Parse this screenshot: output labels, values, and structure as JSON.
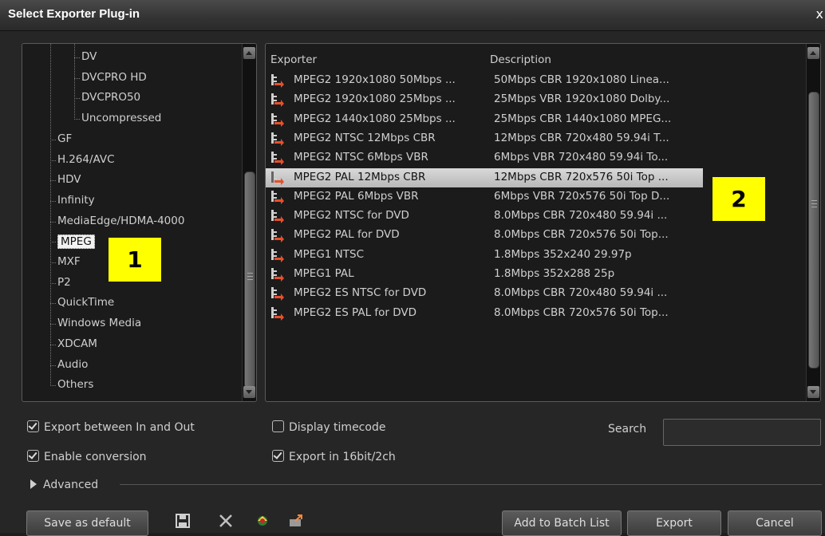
{
  "window": {
    "title": "Select Exporter Plug-in",
    "close_label": "x"
  },
  "tree": {
    "items": [
      {
        "label": "DV",
        "level": 2
      },
      {
        "label": "DVCPRO HD",
        "level": 2
      },
      {
        "label": "DVCPRO50",
        "level": 2
      },
      {
        "label": "Uncompressed",
        "level": 2
      },
      {
        "label": "GF",
        "level": 1
      },
      {
        "label": "H.264/AVC",
        "level": 1
      },
      {
        "label": "HDV",
        "level": 1
      },
      {
        "label": "Infinity",
        "level": 1
      },
      {
        "label": "MediaEdge/HDMA-4000",
        "level": 1
      },
      {
        "label": "MPEG",
        "level": 1,
        "selected": true
      },
      {
        "label": "MXF",
        "level": 1
      },
      {
        "label": "P2",
        "level": 1
      },
      {
        "label": "QuickTime",
        "level": 1
      },
      {
        "label": "Windows Media",
        "level": 1
      },
      {
        "label": "XDCAM",
        "level": 1
      },
      {
        "label": "Audio",
        "level": 1
      },
      {
        "label": "Others",
        "level": 1
      }
    ]
  },
  "list": {
    "columns": {
      "exporter": "Exporter",
      "description": "Description"
    },
    "rows": [
      {
        "exporter": "MPEG2 1920x1080 50Mbps ...",
        "description": "50Mbps CBR 1920x1080 Linea..."
      },
      {
        "exporter": "MPEG2 1920x1080 25Mbps ...",
        "description": "25Mbps VBR 1920x1080 Dolby..."
      },
      {
        "exporter": "MPEG2 1440x1080 25Mbps ...",
        "description": "25Mbps CBR 1440x1080 MPEG..."
      },
      {
        "exporter": "MPEG2 NTSC 12Mbps CBR",
        "description": "12Mbps CBR 720x480 59.94i T..."
      },
      {
        "exporter": "MPEG2 NTSC 6Mbps VBR",
        "description": "6Mbps VBR 720x480 59.94i To..."
      },
      {
        "exporter": "MPEG2 PAL 12Mbps CBR",
        "description": "12Mbps CBR 720x576 50i Top ...",
        "selected": true
      },
      {
        "exporter": "MPEG2 PAL 6Mbps VBR",
        "description": "6Mbps VBR 720x576 50i Top D..."
      },
      {
        "exporter": "MPEG2 NTSC for DVD",
        "description": "8.0Mbps CBR 720x480 59.94i ..."
      },
      {
        "exporter": "MPEG2 PAL for DVD",
        "description": "8.0Mbps CBR 720x576 50i Top..."
      },
      {
        "exporter": "MPEG1 NTSC",
        "description": "1.8Mbps 352x240 29.97p"
      },
      {
        "exporter": "MPEG1 PAL",
        "description": "1.8Mbps 352x288 25p"
      },
      {
        "exporter": "MPEG2 ES NTSC for DVD",
        "description": "8.0Mbps CBR 720x480 59.94i ..."
      },
      {
        "exporter": "MPEG2 ES PAL for DVD",
        "description": "8.0Mbps CBR 720x576 50i Top..."
      }
    ]
  },
  "badges": {
    "b1": "1",
    "b2": "2"
  },
  "options": {
    "export_in_out": "Export between In and Out",
    "enable_conversion": "Enable conversion",
    "display_timecode": "Display timecode",
    "export_16bit": "Export in 16bit/2ch",
    "search_label": "Search",
    "search_value": "",
    "advanced": "Advanced"
  },
  "buttons": {
    "save_default": "Save as default",
    "add_batch": "Add to Batch List",
    "export": "Export",
    "cancel": "Cancel"
  },
  "colors": {
    "badge": "#ffff00",
    "selection": "#d0d0d0",
    "icon_accent": "#e8502a"
  }
}
